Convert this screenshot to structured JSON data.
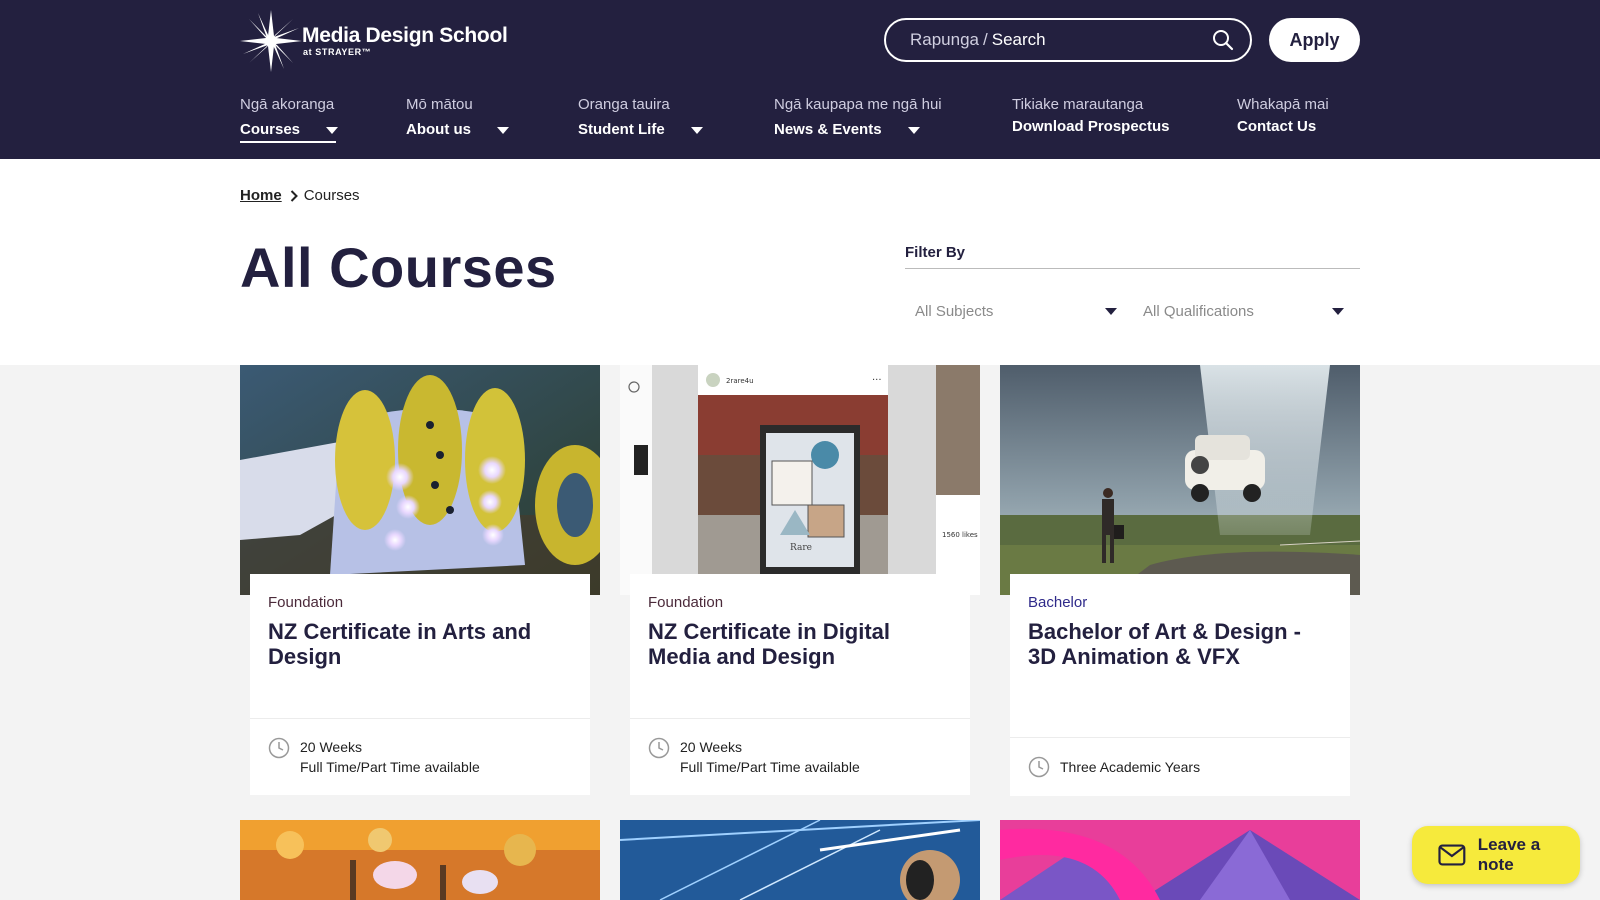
{
  "brand": {
    "name": "Media Design School",
    "sub": "at STRAYER™",
    "colors": {
      "navy": "#23203f",
      "accent_yellow": "#f6ea3c",
      "white": "#ffffff"
    }
  },
  "search": {
    "label_mi": "Rapunga",
    "separator": "/",
    "label_en": "Search",
    "icon": "search-icon"
  },
  "apply_label": "Apply",
  "nav": [
    {
      "mi": "Ngā akoranga",
      "en": "Courses",
      "dropdown": true,
      "active": true
    },
    {
      "mi": "Mō mātou",
      "en": "About us",
      "dropdown": true
    },
    {
      "mi": "Oranga tauira",
      "en": "Student Life",
      "dropdown": true
    },
    {
      "mi": "Ngā kaupapa me ngā hui",
      "en": "News & Events",
      "dropdown": true
    },
    {
      "mi": "Tikiake marautanga",
      "en": "Download Prospectus",
      "dropdown": false
    },
    {
      "mi": "Whakapā mai",
      "en": "Contact Us",
      "dropdown": false
    }
  ],
  "breadcrumb": {
    "home": "Home",
    "current": "Courses"
  },
  "page_title": "All Courses",
  "filter": {
    "label": "Filter By",
    "subjects_placeholder": "All Subjects",
    "qualifications_placeholder": "All Qualifications"
  },
  "cards": [
    {
      "type": "Foundation",
      "title": "NZ Certificate in Arts and Design",
      "duration": "20 Weeks",
      "mode": "Full Time/Part Time available"
    },
    {
      "type": "Foundation",
      "title": "NZ Certificate in Digital Media and Design",
      "duration": "20 Weeks",
      "mode": "Full Time/Part Time available"
    },
    {
      "type": "Bachelor",
      "title": "Bachelor of Art & Design - 3D Animation & VFX",
      "duration": "Three Academic Years",
      "mode": ""
    }
  ],
  "card2_overlay": {
    "handle": "2rare4u",
    "likes": "1560 likes",
    "brand": "Rare"
  },
  "feedback_label": "Leave a note"
}
